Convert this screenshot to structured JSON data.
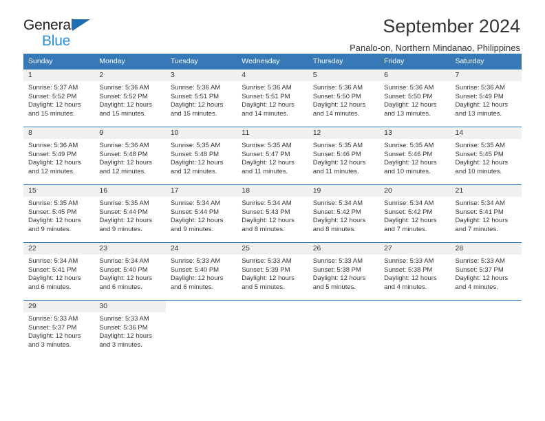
{
  "brand": {
    "name_top": "General",
    "name_bottom": "Blue",
    "triangle_color": "#1f6db5",
    "blue_text_color": "#2a8fd4"
  },
  "header": {
    "title": "September 2024",
    "subtitle": "Panalo-on, Northern Mindanao, Philippines"
  },
  "calendar": {
    "header_bg": "#3778b6",
    "daynum_band_bg": "#f0f0f0",
    "columns": [
      "Sunday",
      "Monday",
      "Tuesday",
      "Wednesday",
      "Thursday",
      "Friday",
      "Saturday"
    ],
    "weeks": [
      [
        {
          "day": "1",
          "sunrise": "Sunrise: 5:37 AM",
          "sunset": "Sunset: 5:52 PM",
          "daylight_1": "Daylight: 12 hours",
          "daylight_2": "and 15 minutes."
        },
        {
          "day": "2",
          "sunrise": "Sunrise: 5:36 AM",
          "sunset": "Sunset: 5:52 PM",
          "daylight_1": "Daylight: 12 hours",
          "daylight_2": "and 15 minutes."
        },
        {
          "day": "3",
          "sunrise": "Sunrise: 5:36 AM",
          "sunset": "Sunset: 5:51 PM",
          "daylight_1": "Daylight: 12 hours",
          "daylight_2": "and 15 minutes."
        },
        {
          "day": "4",
          "sunrise": "Sunrise: 5:36 AM",
          "sunset": "Sunset: 5:51 PM",
          "daylight_1": "Daylight: 12 hours",
          "daylight_2": "and 14 minutes."
        },
        {
          "day": "5",
          "sunrise": "Sunrise: 5:36 AM",
          "sunset": "Sunset: 5:50 PM",
          "daylight_1": "Daylight: 12 hours",
          "daylight_2": "and 14 minutes."
        },
        {
          "day": "6",
          "sunrise": "Sunrise: 5:36 AM",
          "sunset": "Sunset: 5:50 PM",
          "daylight_1": "Daylight: 12 hours",
          "daylight_2": "and 13 minutes."
        },
        {
          "day": "7",
          "sunrise": "Sunrise: 5:36 AM",
          "sunset": "Sunset: 5:49 PM",
          "daylight_1": "Daylight: 12 hours",
          "daylight_2": "and 13 minutes."
        }
      ],
      [
        {
          "day": "8",
          "sunrise": "Sunrise: 5:36 AM",
          "sunset": "Sunset: 5:49 PM",
          "daylight_1": "Daylight: 12 hours",
          "daylight_2": "and 12 minutes."
        },
        {
          "day": "9",
          "sunrise": "Sunrise: 5:36 AM",
          "sunset": "Sunset: 5:48 PM",
          "daylight_1": "Daylight: 12 hours",
          "daylight_2": "and 12 minutes."
        },
        {
          "day": "10",
          "sunrise": "Sunrise: 5:35 AM",
          "sunset": "Sunset: 5:48 PM",
          "daylight_1": "Daylight: 12 hours",
          "daylight_2": "and 12 minutes."
        },
        {
          "day": "11",
          "sunrise": "Sunrise: 5:35 AM",
          "sunset": "Sunset: 5:47 PM",
          "daylight_1": "Daylight: 12 hours",
          "daylight_2": "and 11 minutes."
        },
        {
          "day": "12",
          "sunrise": "Sunrise: 5:35 AM",
          "sunset": "Sunset: 5:46 PM",
          "daylight_1": "Daylight: 12 hours",
          "daylight_2": "and 11 minutes."
        },
        {
          "day": "13",
          "sunrise": "Sunrise: 5:35 AM",
          "sunset": "Sunset: 5:46 PM",
          "daylight_1": "Daylight: 12 hours",
          "daylight_2": "and 10 minutes."
        },
        {
          "day": "14",
          "sunrise": "Sunrise: 5:35 AM",
          "sunset": "Sunset: 5:45 PM",
          "daylight_1": "Daylight: 12 hours",
          "daylight_2": "and 10 minutes."
        }
      ],
      [
        {
          "day": "15",
          "sunrise": "Sunrise: 5:35 AM",
          "sunset": "Sunset: 5:45 PM",
          "daylight_1": "Daylight: 12 hours",
          "daylight_2": "and 9 minutes."
        },
        {
          "day": "16",
          "sunrise": "Sunrise: 5:35 AM",
          "sunset": "Sunset: 5:44 PM",
          "daylight_1": "Daylight: 12 hours",
          "daylight_2": "and 9 minutes."
        },
        {
          "day": "17",
          "sunrise": "Sunrise: 5:34 AM",
          "sunset": "Sunset: 5:44 PM",
          "daylight_1": "Daylight: 12 hours",
          "daylight_2": "and 9 minutes."
        },
        {
          "day": "18",
          "sunrise": "Sunrise: 5:34 AM",
          "sunset": "Sunset: 5:43 PM",
          "daylight_1": "Daylight: 12 hours",
          "daylight_2": "and 8 minutes."
        },
        {
          "day": "19",
          "sunrise": "Sunrise: 5:34 AM",
          "sunset": "Sunset: 5:42 PM",
          "daylight_1": "Daylight: 12 hours",
          "daylight_2": "and 8 minutes."
        },
        {
          "day": "20",
          "sunrise": "Sunrise: 5:34 AM",
          "sunset": "Sunset: 5:42 PM",
          "daylight_1": "Daylight: 12 hours",
          "daylight_2": "and 7 minutes."
        },
        {
          "day": "21",
          "sunrise": "Sunrise: 5:34 AM",
          "sunset": "Sunset: 5:41 PM",
          "daylight_1": "Daylight: 12 hours",
          "daylight_2": "and 7 minutes."
        }
      ],
      [
        {
          "day": "22",
          "sunrise": "Sunrise: 5:34 AM",
          "sunset": "Sunset: 5:41 PM",
          "daylight_1": "Daylight: 12 hours",
          "daylight_2": "and 6 minutes."
        },
        {
          "day": "23",
          "sunrise": "Sunrise: 5:34 AM",
          "sunset": "Sunset: 5:40 PM",
          "daylight_1": "Daylight: 12 hours",
          "daylight_2": "and 6 minutes."
        },
        {
          "day": "24",
          "sunrise": "Sunrise: 5:33 AM",
          "sunset": "Sunset: 5:40 PM",
          "daylight_1": "Daylight: 12 hours",
          "daylight_2": "and 6 minutes."
        },
        {
          "day": "25",
          "sunrise": "Sunrise: 5:33 AM",
          "sunset": "Sunset: 5:39 PM",
          "daylight_1": "Daylight: 12 hours",
          "daylight_2": "and 5 minutes."
        },
        {
          "day": "26",
          "sunrise": "Sunrise: 5:33 AM",
          "sunset": "Sunset: 5:38 PM",
          "daylight_1": "Daylight: 12 hours",
          "daylight_2": "and 5 minutes."
        },
        {
          "day": "27",
          "sunrise": "Sunrise: 5:33 AM",
          "sunset": "Sunset: 5:38 PM",
          "daylight_1": "Daylight: 12 hours",
          "daylight_2": "and 4 minutes."
        },
        {
          "day": "28",
          "sunrise": "Sunrise: 5:33 AM",
          "sunset": "Sunset: 5:37 PM",
          "daylight_1": "Daylight: 12 hours",
          "daylight_2": "and 4 minutes."
        }
      ],
      [
        {
          "day": "29",
          "sunrise": "Sunrise: 5:33 AM",
          "sunset": "Sunset: 5:37 PM",
          "daylight_1": "Daylight: 12 hours",
          "daylight_2": "and 3 minutes."
        },
        {
          "day": "30",
          "sunrise": "Sunrise: 5:33 AM",
          "sunset": "Sunset: 5:36 PM",
          "daylight_1": "Daylight: 12 hours",
          "daylight_2": "and 3 minutes."
        },
        {
          "day": "",
          "sunrise": "",
          "sunset": "",
          "daylight_1": "",
          "daylight_2": ""
        },
        {
          "day": "",
          "sunrise": "",
          "sunset": "",
          "daylight_1": "",
          "daylight_2": ""
        },
        {
          "day": "",
          "sunrise": "",
          "sunset": "",
          "daylight_1": "",
          "daylight_2": ""
        },
        {
          "day": "",
          "sunrise": "",
          "sunset": "",
          "daylight_1": "",
          "daylight_2": ""
        },
        {
          "day": "",
          "sunrise": "",
          "sunset": "",
          "daylight_1": "",
          "daylight_2": ""
        }
      ]
    ]
  }
}
